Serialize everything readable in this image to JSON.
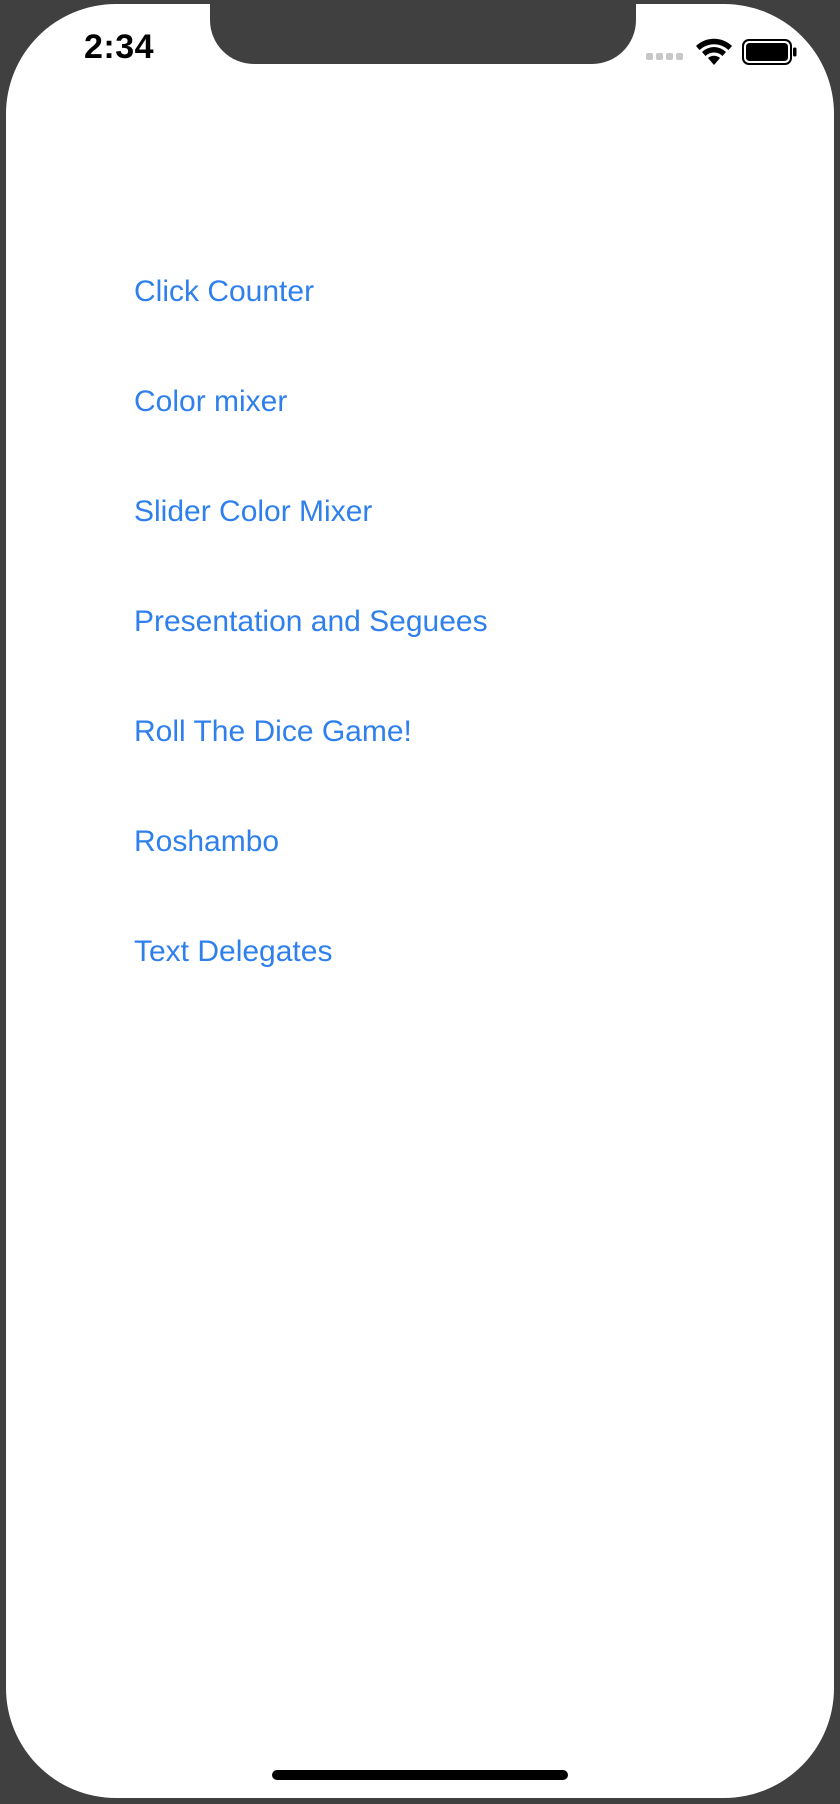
{
  "status_bar": {
    "time": "2:34",
    "signal_icon": "cellular-signal-icon",
    "wifi_icon": "wifi-icon",
    "battery_icon": "battery-icon"
  },
  "menu": {
    "items": [
      {
        "label": "Click Counter"
      },
      {
        "label": "Color mixer"
      },
      {
        "label": "Slider Color Mixer"
      },
      {
        "label": "Presentation and Seguees"
      },
      {
        "label": "Roll The Dice Game!"
      },
      {
        "label": "Roshambo"
      },
      {
        "label": "Text Delegates"
      }
    ]
  },
  "colors": {
    "link": "#2f80ed",
    "frame": "#404040",
    "background": "#ffffff"
  }
}
